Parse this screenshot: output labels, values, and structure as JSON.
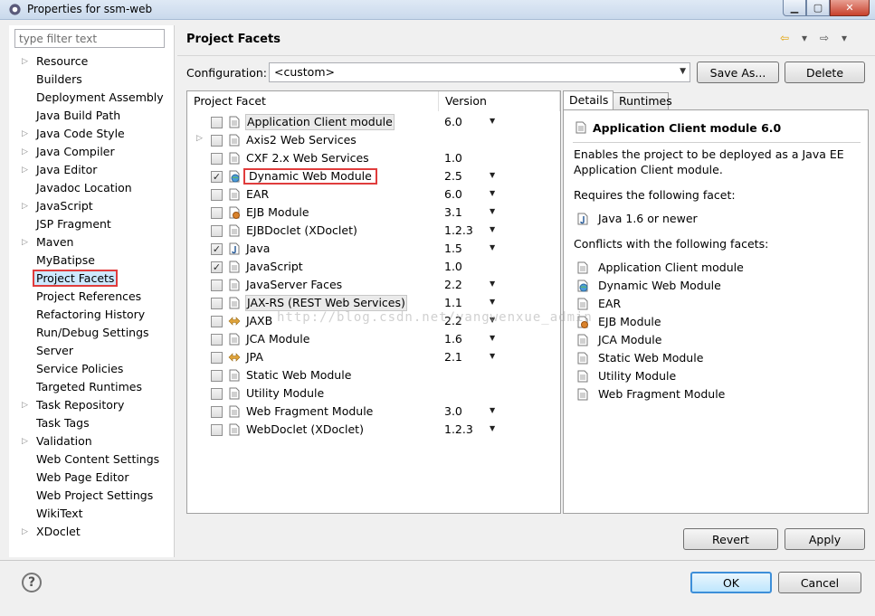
{
  "window": {
    "title": "Properties for ssm-web"
  },
  "filter": {
    "placeholder": "type filter text"
  },
  "nav": {
    "items": [
      {
        "label": "Resource",
        "arrow": true
      },
      {
        "label": "Builders",
        "arrow": false
      },
      {
        "label": "Deployment Assembly",
        "arrow": false
      },
      {
        "label": "Java Build Path",
        "arrow": false
      },
      {
        "label": "Java Code Style",
        "arrow": true
      },
      {
        "label": "Java Compiler",
        "arrow": true
      },
      {
        "label": "Java Editor",
        "arrow": true
      },
      {
        "label": "Javadoc Location",
        "arrow": false
      },
      {
        "label": "JavaScript",
        "arrow": true
      },
      {
        "label": "JSP Fragment",
        "arrow": false
      },
      {
        "label": "Maven",
        "arrow": true
      },
      {
        "label": "MyBatipse",
        "arrow": false
      },
      {
        "label": "Project Facets",
        "arrow": false,
        "selected": true
      },
      {
        "label": "Project References",
        "arrow": false
      },
      {
        "label": "Refactoring History",
        "arrow": false
      },
      {
        "label": "Run/Debug Settings",
        "arrow": false
      },
      {
        "label": "Server",
        "arrow": false
      },
      {
        "label": "Service Policies",
        "arrow": false
      },
      {
        "label": "Targeted Runtimes",
        "arrow": false
      },
      {
        "label": "Task Repository",
        "arrow": true
      },
      {
        "label": "Task Tags",
        "arrow": false
      },
      {
        "label": "Validation",
        "arrow": true
      },
      {
        "label": "Web Content Settings",
        "arrow": false
      },
      {
        "label": "Web Page Editor",
        "arrow": false
      },
      {
        "label": "Web Project Settings",
        "arrow": false
      },
      {
        "label": "WikiText",
        "arrow": false
      },
      {
        "label": "XDoclet",
        "arrow": true
      }
    ]
  },
  "header": {
    "title": "Project Facets"
  },
  "config": {
    "label": "Configuration:",
    "value": "<custom>",
    "save_as": "Save As...",
    "delete": "Delete"
  },
  "table": {
    "col_facet": "Project Facet",
    "col_version": "Version",
    "rows": [
      {
        "name": "Application Client module",
        "version": "6.0",
        "checked": false,
        "dropdown": true,
        "icon": "page",
        "style": "hl",
        "twisty": false
      },
      {
        "name": "Axis2 Web Services",
        "version": "",
        "checked": false,
        "dropdown": false,
        "icon": "page",
        "style": "",
        "twisty": true
      },
      {
        "name": "CXF 2.x Web Services",
        "version": "1.0",
        "checked": false,
        "dropdown": false,
        "icon": "page",
        "style": "",
        "twisty": false
      },
      {
        "name": "Dynamic Web Module",
        "version": "2.5",
        "checked": true,
        "dropdown": true,
        "icon": "globe",
        "style": "red",
        "twisty": false
      },
      {
        "name": "EAR",
        "version": "6.0",
        "checked": false,
        "dropdown": true,
        "icon": "page",
        "style": "",
        "twisty": false
      },
      {
        "name": "EJB Module",
        "version": "3.1",
        "checked": false,
        "dropdown": true,
        "icon": "bean",
        "style": "",
        "twisty": false
      },
      {
        "name": "EJBDoclet (XDoclet)",
        "version": "1.2.3",
        "checked": false,
        "dropdown": true,
        "icon": "page",
        "style": "",
        "twisty": false
      },
      {
        "name": "Java",
        "version": "1.5",
        "checked": true,
        "dropdown": true,
        "icon": "java",
        "style": "",
        "twisty": false
      },
      {
        "name": "JavaScript",
        "version": "1.0",
        "checked": true,
        "dropdown": false,
        "icon": "page",
        "style": "",
        "twisty": false
      },
      {
        "name": "JavaServer Faces",
        "version": "2.2",
        "checked": false,
        "dropdown": true,
        "icon": "page",
        "style": "",
        "twisty": false
      },
      {
        "name": "JAX-RS (REST Web Services)",
        "version": "1.1",
        "checked": false,
        "dropdown": true,
        "icon": "page",
        "style": "hl",
        "twisty": false
      },
      {
        "name": "JAXB",
        "version": "2.2",
        "checked": false,
        "dropdown": true,
        "icon": "arrows",
        "style": "",
        "twisty": false
      },
      {
        "name": "JCA Module",
        "version": "1.6",
        "checked": false,
        "dropdown": true,
        "icon": "page",
        "style": "",
        "twisty": false
      },
      {
        "name": "JPA",
        "version": "2.1",
        "checked": false,
        "dropdown": true,
        "icon": "arrows",
        "style": "",
        "twisty": false
      },
      {
        "name": "Static Web Module",
        "version": "",
        "checked": false,
        "dropdown": false,
        "icon": "page",
        "style": "",
        "twisty": false
      },
      {
        "name": "Utility Module",
        "version": "",
        "checked": false,
        "dropdown": false,
        "icon": "page",
        "style": "",
        "twisty": false
      },
      {
        "name": "Web Fragment Module",
        "version": "3.0",
        "checked": false,
        "dropdown": true,
        "icon": "page",
        "style": "",
        "twisty": false
      },
      {
        "name": "WebDoclet (XDoclet)",
        "version": "1.2.3",
        "checked": false,
        "dropdown": true,
        "icon": "page",
        "style": "",
        "twisty": false
      }
    ]
  },
  "details": {
    "tab_details": "Details",
    "tab_runtimes": "Runtimes",
    "title": "Application Client module 6.0",
    "description": "Enables the project to be deployed as a Java EE Application Client module.",
    "requires_label": "Requires the following facet:",
    "requires": [
      {
        "name": "Java 1.6 or newer",
        "icon": "java"
      }
    ],
    "conflicts_label": "Conflicts with the following facets:",
    "conflicts": [
      {
        "name": "Application Client module",
        "icon": "page"
      },
      {
        "name": "Dynamic Web Module",
        "icon": "globe"
      },
      {
        "name": "EAR",
        "icon": "page"
      },
      {
        "name": "EJB Module",
        "icon": "bean"
      },
      {
        "name": "JCA Module",
        "icon": "page"
      },
      {
        "name": "Static Web Module",
        "icon": "page"
      },
      {
        "name": "Utility Module",
        "icon": "page"
      },
      {
        "name": "Web Fragment Module",
        "icon": "page"
      }
    ]
  },
  "buttons": {
    "revert": "Revert",
    "apply": "Apply",
    "ok": "OK",
    "cancel": "Cancel"
  },
  "watermark": "http://blog.csdn.net/yangwenxue_admin"
}
